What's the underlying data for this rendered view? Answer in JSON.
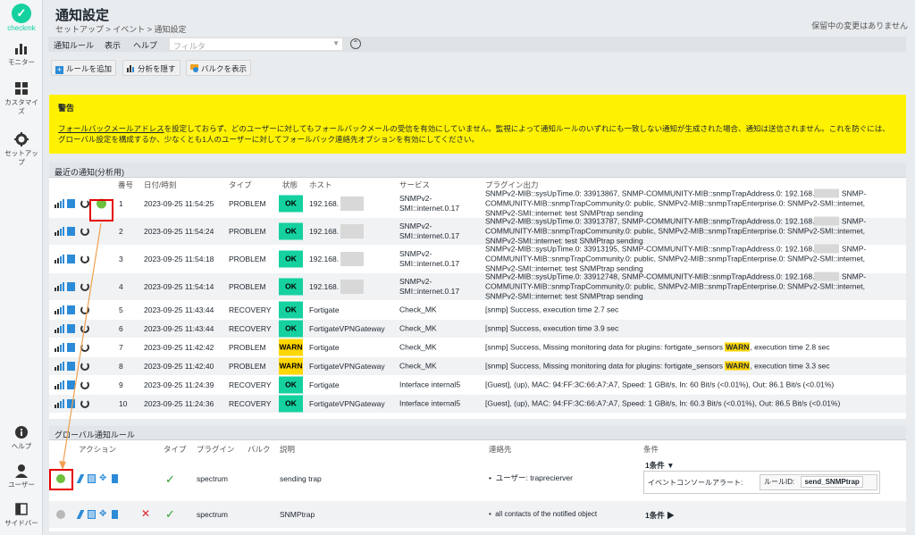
{
  "brand": {
    "logo_text": "checkmk",
    "logo_glyph": "✓"
  },
  "sidebar": {
    "items": [
      {
        "label": "モニター",
        "icon": "monitor-icon"
      },
      {
        "label": "カスタマイズ",
        "icon": "customize-icon"
      },
      {
        "label": "セットアップ",
        "icon": "setup-icon"
      },
      {
        "label": "ヘルプ",
        "icon": "help-icon"
      },
      {
        "label": "ユーザー",
        "icon": "user-icon"
      },
      {
        "label": "サイドバー",
        "icon": "sidebar-icon"
      }
    ]
  },
  "header": {
    "title": "通知設定",
    "breadcrumb": "セットアップ > イベント > 通知設定",
    "pending": "保留中の変更はありません"
  },
  "menubar": {
    "items": [
      "通知ルール",
      "表示",
      "ヘルプ"
    ],
    "filter_placeholder": "フィルタ",
    "collapse": "⌃"
  },
  "toolbar": {
    "add_rule": "ルールを追加",
    "hide_analysis": "分析を隠す",
    "show_bulk": "バルクを表示"
  },
  "warning": {
    "title": "警告",
    "link": "フォールバックメールアドレス",
    "text1": "を設定しておらず、どのユーザーに対してもフォールバックメールの受信を有効にしていません。監視によって通知ルールのいずれにも一致しない通知が生成された場合、通知は送信されません。これを防ぐには、グローバル設定を構成するか、少なくとも1人のユーザーに対してフォールバック連絡先オプションを有効にしてください。"
  },
  "recent": {
    "heading": "最近の通知(分析用)",
    "headers": [
      "番号",
      "日付/時刻",
      "タイプ",
      "状態",
      "ホスト",
      "サービス",
      "プラグイン出力"
    ],
    "rows": [
      {
        "num": "1",
        "datetime": "2023-09-25 11:54:25",
        "type": "PROBLEM",
        "state": "OK",
        "host": "192.168.",
        "service": "SNMPv2-SMI::internet.0.17",
        "plugin": [
          "SNMPv2-MIB::sysUpTime.0: 33913867, SNMP-COMMUNITY-MIB::snmpTrapAddress.0: 192.168.",
          " SNMP-COMMUNITY-MIB::snmpTrapCommunity.0: public, SNMPv2-MIB::snmpTrapEnterprise.0: SNMPv2-SMI::internet, SNMPv2-SMI::internet: test SNMPtrap sending"
        ]
      },
      {
        "num": "2",
        "datetime": "2023-09-25 11:54:24",
        "type": "PROBLEM",
        "state": "OK",
        "host": "192.168.",
        "service": "SNMPv2-SMI::internet.0.17",
        "plugin": [
          "SNMPv2-MIB::sysUpTime.0: 33913787, SNMP-COMMUNITY-MIB::snmpTrapAddress.0: 192.168.",
          " SNMP-COMMUNITY-MIB::snmpTrapCommunity.0: public, SNMPv2-MIB::snmpTrapEnterprise.0: SNMPv2-SMI::internet, SNMPv2-SMI::internet: test SNMPtrap sending"
        ]
      },
      {
        "num": "3",
        "datetime": "2023-09-25 11:54:18",
        "type": "PROBLEM",
        "state": "OK",
        "host": "192.168.",
        "service": "SNMPv2-SMI::internet.0.17",
        "plugin": [
          "SNMPv2-MIB::sysUpTime.0: 33913195, SNMP-COMMUNITY-MIB::snmpTrapAddress.0: 192.168.",
          " SNMP-COMMUNITY-MIB::snmpTrapCommunity.0: public, SNMPv2-MIB::snmpTrapEnterprise.0: SNMPv2-SMI::internet, SNMPv2-SMI::internet: test SNMPtrap sending"
        ]
      },
      {
        "num": "4",
        "datetime": "2023-09-25 11:54:14",
        "type": "PROBLEM",
        "state": "OK",
        "host": "192.168.",
        "service": "SNMPv2-SMI::internet.0.17",
        "plugin": [
          "SNMPv2-MIB::sysUpTime.0: 33912748, SNMP-COMMUNITY-MIB::snmpTrapAddress.0: 192.168.",
          " SNMP-COMMUNITY-MIB::snmpTrapCommunity.0: public, SNMPv2-MIB::snmpTrapEnterprise.0: SNMPv2-SMI::internet, SNMPv2-SMI::internet: test SNMPtrap sending"
        ]
      },
      {
        "num": "5",
        "datetime": "2023-09-25 11:43:44",
        "type": "RECOVERY",
        "state": "OK",
        "host": "Fortigate",
        "service": "Check_MK",
        "plugin": [
          "[snmp] Success, execution time 2.7 sec"
        ]
      },
      {
        "num": "6",
        "datetime": "2023-09-25 11:43:44",
        "type": "RECOVERY",
        "state": "OK",
        "host": "FortigateVPNGateway",
        "service": "Check_MK",
        "plugin": [
          "[snmp] Success, execution time 3.9 sec"
        ]
      },
      {
        "num": "7",
        "datetime": "2023-09-25 11:42:42",
        "type": "PROBLEM",
        "state": "WARN",
        "host": "Fortigate",
        "service": "Check_MK",
        "plugin": [
          "[snmp] Success, Missing monitoring data for plugins: fortigate_sensors",
          "WARN",
          ", execution time 2.8 sec"
        ]
      },
      {
        "num": "8",
        "datetime": "2023-09-25 11:42:40",
        "type": "PROBLEM",
        "state": "WARN",
        "host": "FortigateVPNGateway",
        "service": "Check_MK",
        "plugin": [
          "[snmp] Success, Missing monitoring data for plugins: fortigate_sensors",
          "WARN",
          ", execution time 3.3 sec"
        ]
      },
      {
        "num": "9",
        "datetime": "2023-09-25 11:24:39",
        "type": "RECOVERY",
        "state": "OK",
        "host": "Fortigate",
        "service": "Interface internal5",
        "plugin": [
          "[Guest], (up), MAC: 94:FF:3C:66:A7:A7, Speed: 1 GBit/s, In: 60 Bit/s (<0.01%), Out: 86.1 Bit/s (<0.01%)"
        ]
      },
      {
        "num": "10",
        "datetime": "2023-09-25 11:24:36",
        "type": "RECOVERY",
        "state": "OK",
        "host": "FortigateVPNGateway",
        "service": "Interface internal5",
        "plugin": [
          "[Guest], (up), MAC: 94:FF:3C:66:A7:A7, Speed: 1 GBit/s, In: 60.3 Bit/s (<0.01%), Out: 86.5 Bit/s (<0.01%)"
        ]
      }
    ]
  },
  "global_rules": {
    "heading": "グローバル通知ルール",
    "headers": [
      "アクション",
      "タイプ",
      "プラグイン",
      "バルク",
      "説明",
      "連絡先",
      "条件"
    ],
    "rows": [
      {
        "plugin": "spectrum",
        "description": "sending trap",
        "contact": "ユーザー: traprecierver",
        "conditions": "1条件 ▼",
        "cond_label": "イベントコンソールアラート:",
        "cond_key": "ルールID:",
        "cond_value": "send_SNMPtrap",
        "dot_color": "#6dbf3e"
      },
      {
        "plugin": "spectrum",
        "description": "SNMPtrap",
        "contact": "all contacts of the notified object",
        "conditions": "1条件 ▶",
        "dot_color": "#b8b8b8"
      }
    ]
  },
  "colors": {
    "ok": "#15d1a0",
    "warn": "#ffd703",
    "warning_bg": "#fff200",
    "brand": "#15d1a0",
    "highlight": "#e50000",
    "arrow": "#f0a050"
  }
}
